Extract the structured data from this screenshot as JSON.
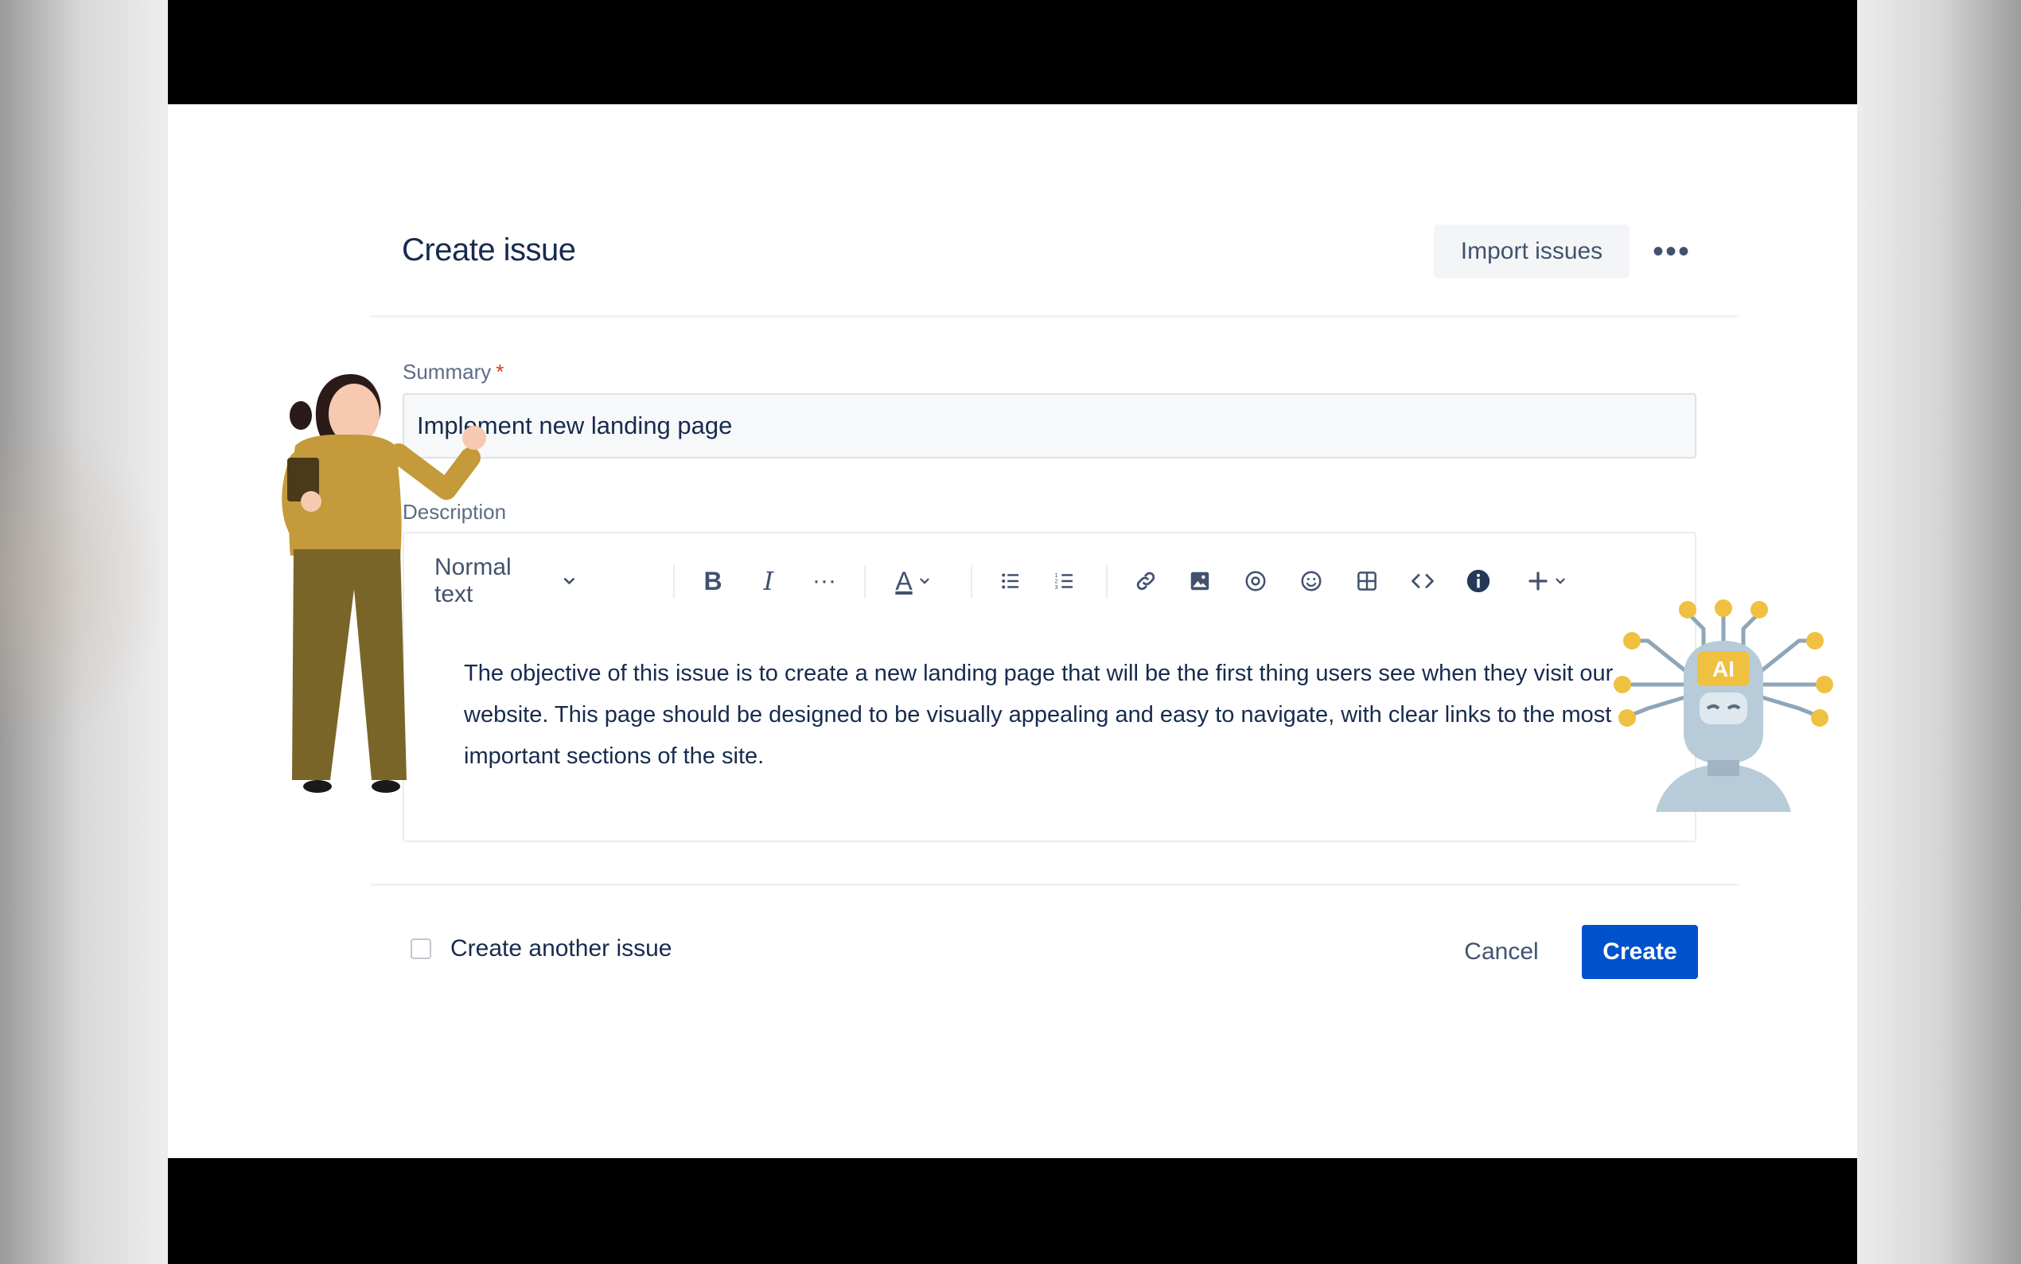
{
  "dialog": {
    "title": "Create issue",
    "import_label": "Import issues",
    "more_label": "•••"
  },
  "summary": {
    "label": "Summary",
    "required_marker": "*",
    "value": "Implement new landing page"
  },
  "description": {
    "label": "Description",
    "text_style": "Normal text",
    "content": "The objective of this issue is to create a new landing page that will be the first thing users see when they visit our website. This page should be designed to be visually appealing and easy to navigate, with clear links to the most important sections of the site."
  },
  "toolbar": {
    "icons": [
      "chevron-down-icon",
      "bold-icon",
      "italic-icon",
      "more-formatting-icon",
      "text-color-icon",
      "bullet-list-icon",
      "numbered-list-icon",
      "link-icon",
      "image-icon",
      "mention-icon",
      "emoji-icon",
      "table-icon",
      "code-icon",
      "info-icon",
      "insert-icon"
    ],
    "bold": "B",
    "italic": "I",
    "more": "···",
    "text_color": "A"
  },
  "footer": {
    "create_another_label": "Create another issue",
    "create_another_checked": false,
    "cancel_label": "Cancel",
    "create_label": "Create"
  },
  "illustration": {
    "robot_badge": "AI"
  },
  "colors": {
    "primary": "#0052cc",
    "text": "#172b4d",
    "subtle_text": "#42526e",
    "required": "#de350b"
  }
}
